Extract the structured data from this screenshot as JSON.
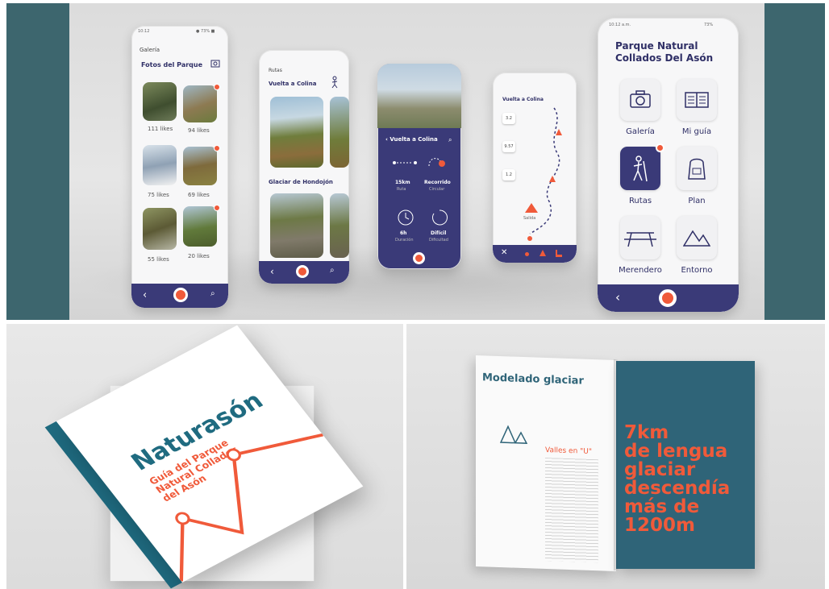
{
  "gallery": {
    "time": "10:12",
    "status": "● 73% ■",
    "section": "Galería",
    "title": "Fotos del Parque",
    "likes": [
      "111 likes",
      "94 likes",
      "75 likes",
      "69 likes",
      "55 likes",
      "20 likes"
    ]
  },
  "routes": {
    "section": "Rutas",
    "route1": "Vuelta a Colina",
    "route2": "Glaciar de Hondojón"
  },
  "detail": {
    "title": "Vuelta a Colina",
    "distance": "15km",
    "distance_label": "Ruta",
    "type": "Recorrido",
    "type_label": "Circular",
    "time": "6h",
    "time_label": "Duración",
    "level": "Difícil",
    "level_label": "Dificultad"
  },
  "map": {
    "title": "Vuelta a Colina",
    "marks": [
      "3.2",
      "9.57",
      "1.2"
    ],
    "start_label": "Salida"
  },
  "home": {
    "time": "10:12 a.m.",
    "status": "73%",
    "title_line1": "Parque Natural",
    "title_line2": "Collados Del Asón",
    "tiles": [
      "Galería",
      "Mi guía",
      "Rutas",
      "Plan",
      "Merendero",
      "Entorno"
    ]
  },
  "book": {
    "brand": "Naturasón",
    "subtitle_line1": "Guía del Parque",
    "subtitle_line2": "Natural Collados",
    "subtitle_line3": "del Asón"
  },
  "magazine": {
    "heading": "Modelado glaciar",
    "subheading": "Valles en \"U\"",
    "big_line1": "7km",
    "big_line2": "de lengua",
    "big_line3": "glaciar",
    "big_line4": "descendía",
    "big_line5": "más de",
    "big_line6": "1200m"
  },
  "colors": {
    "navy": "#3a3a78",
    "accent": "#f05a3a",
    "teal": "#2f6478"
  }
}
